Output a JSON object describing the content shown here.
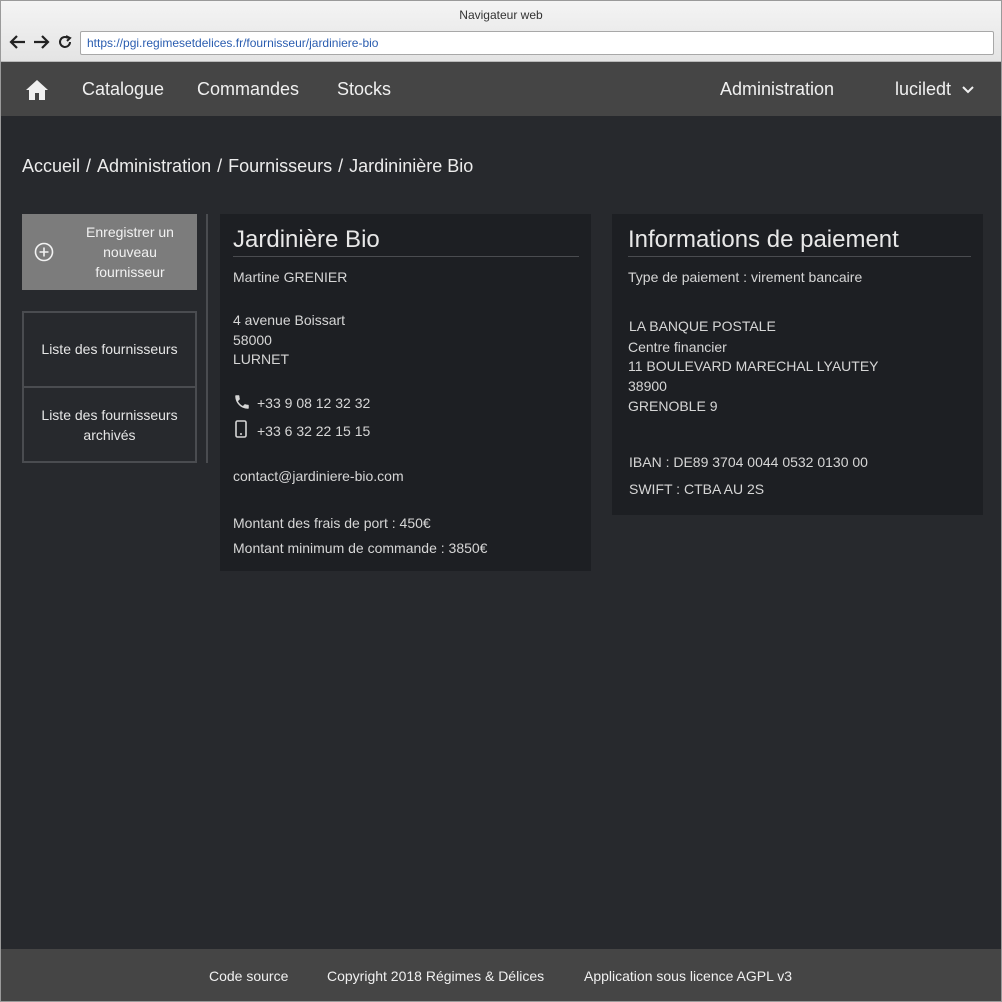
{
  "browser": {
    "title": "Navigateur web",
    "url": "https://pgi.regimesetdelices.fr/fournisseur/jardiniere-bio"
  },
  "topnav": {
    "items": [
      "Catalogue",
      "Commandes",
      "Stocks"
    ],
    "admin": "Administration",
    "user": "luciledt"
  },
  "breadcrumb": [
    "Accueil",
    "Administration",
    "Fournisseurs",
    "Jardininière Bio"
  ],
  "sidebar": {
    "add_button": "Enregistrer un nouveau fournisseur",
    "links": [
      "Liste des fournisseurs",
      "Liste des fournisseurs archivés"
    ]
  },
  "supplier": {
    "name": "Jardinière Bio",
    "contact": "Martine GRENIER",
    "address": [
      "4 avenue Boissart",
      "58000",
      "LURNET"
    ],
    "phone": "+33 9 08 12 32 32",
    "mobile": "+33 6 32 22 15 15",
    "email": "contact@jardiniere-bio.com",
    "shipping_fee": "Montant des frais de port : 450€",
    "min_order": "Montant minimum de commande : 3850€"
  },
  "payment": {
    "title": "Informations de paiement",
    "type": "Type de paiement : virement bancaire",
    "bank": [
      "LA BANQUE POSTALE",
      "Centre financier",
      "11 BOULEVARD MARECHAL LYAUTEY",
      "38900",
      "GRENOBLE 9"
    ],
    "iban": "IBAN : DE89 3704 0044 0532 0130 00",
    "swift": "SWIFT : CTBA AU 2S"
  },
  "footer": {
    "source": "Code source",
    "copyright": "Copyright 2018 Régimes & Délices",
    "license": "Application sous licence AGPL v3"
  },
  "colors": {
    "background": "#27292d",
    "panel": "#1d1f23",
    "nav": "#454545",
    "button": "#7c7c7c"
  },
  "icons": [
    "back-icon",
    "forward-icon",
    "reload-icon",
    "home-icon",
    "chevron-down-icon",
    "plus-circle-icon",
    "phone-icon",
    "mobile-icon"
  ]
}
